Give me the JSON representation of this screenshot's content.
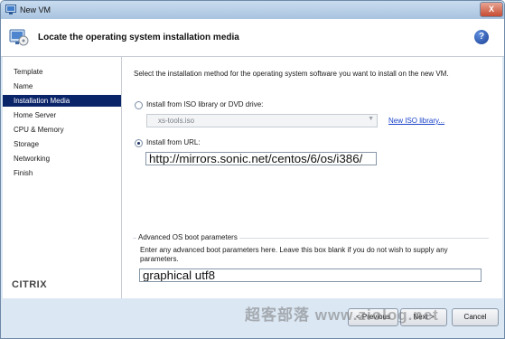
{
  "window": {
    "title": "New VM",
    "controls": {
      "close": "X"
    }
  },
  "header": {
    "title": "Locate the operating system installation media",
    "help_label": "?"
  },
  "sidebar": {
    "items": [
      {
        "label": "Template",
        "active": false
      },
      {
        "label": "Name",
        "active": false
      },
      {
        "label": "Installation Media",
        "active": true
      },
      {
        "label": "Home Server",
        "active": false
      },
      {
        "label": "CPU & Memory",
        "active": false
      },
      {
        "label": "Storage",
        "active": false
      },
      {
        "label": "Networking",
        "active": false
      },
      {
        "label": "Finish",
        "active": false
      }
    ],
    "logo_text": "CITRIX"
  },
  "main": {
    "instruction": "Select the installation method for the operating system software you want to install on the new VM.",
    "iso_option": {
      "label": "Install from ISO library or DVD drive:",
      "selected": false,
      "dropdown_value": "xs-tools.iso",
      "link_label": "New ISO library..."
    },
    "url_option": {
      "label": "Install from URL:",
      "selected": true,
      "value": "http://mirrors.sonic.net/centos/6/os/i386/"
    },
    "boot_params": {
      "legend": "Advanced OS boot parameters",
      "description": "Enter any advanced boot parameters here. Leave this box blank if you do not wish to supply any parameters.",
      "value": "graphical utf8"
    }
  },
  "footer": {
    "previous_label": "< Previous",
    "next_label": "Next >",
    "cancel_label": "Cancel"
  },
  "watermark": "超客部落 www.ziolog.net",
  "colors": {
    "selection": "#0a246a",
    "link": "#1a44c8",
    "window_frame": "#dbe7f3"
  }
}
